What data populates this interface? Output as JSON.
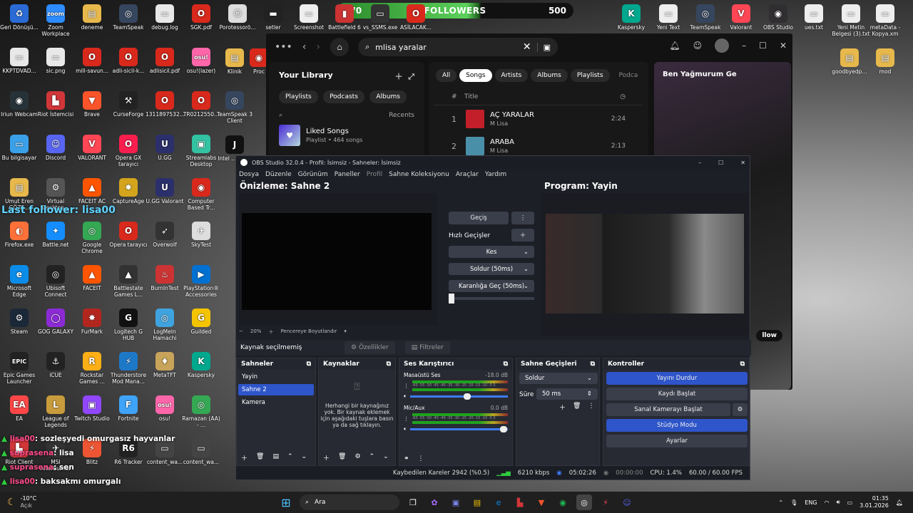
{
  "overlay": {
    "follow_current": "270",
    "follow_label": "FOLLOWERS",
    "follow_goal": "500",
    "last_follower": "Last follower: lisa00"
  },
  "desktop_icons": [
    {
      "label": "Geri Dönüşü...",
      "color": "#2a6bd6",
      "glyph": "♻"
    },
    {
      "label": "Zoom Workplace",
      "color": "#2d8cff",
      "glyph": "zoom"
    },
    {
      "label": "deneme",
      "color": "#e7b84b",
      "glyph": "▤"
    },
    {
      "label": "TeamSpeak",
      "color": "#36465e",
      "glyph": "◎"
    },
    {
      "label": "debug.log",
      "color": "#e8e8e8",
      "glyph": "▭"
    },
    {
      "label": "SGK.pdf",
      "color": "#d9291c",
      "glyph": "O"
    },
    {
      "label": "KKPTDVAD...",
      "color": "#e8e8e8",
      "glyph": "▭"
    },
    {
      "label": "sic.png",
      "color": "#e8e8e8",
      "glyph": "▭"
    },
    {
      "label": "mill-savun...",
      "color": "#d9291c",
      "glyph": "O"
    },
    {
      "label": "adli-sicil-k...",
      "color": "#d9291c",
      "glyph": "O"
    },
    {
      "label": "adlisicil.pdf",
      "color": "#d9291c",
      "glyph": "O"
    },
    {
      "label": "osu!(lazer)",
      "color": "#ff66aa",
      "glyph": "osu!"
    },
    {
      "label": "Iriun Webcam",
      "color": "#263238",
      "glyph": "◉"
    },
    {
      "label": "Riot İstemcisi",
      "color": "#d13639",
      "glyph": "▙"
    },
    {
      "label": "Brave",
      "color": "#fb542b",
      "glyph": "▼"
    },
    {
      "label": "CurseForge",
      "color": "#222",
      "glyph": "⚒"
    },
    {
      "label": "1311897532...",
      "color": "#d9291c",
      "glyph": "O"
    },
    {
      "label": "TR0212550...",
      "color": "#d9291c",
      "glyph": "O"
    },
    {
      "label": "Bu bilgisayar",
      "color": "#3aa0e8",
      "glyph": "▭"
    },
    {
      "label": "Discord",
      "color": "#5865f2",
      "glyph": "☺"
    },
    {
      "label": "VALORANT",
      "color": "#ff4655",
      "glyph": "V"
    },
    {
      "label": "Opera GX tarayıcı",
      "color": "#fa1e4e",
      "glyph": "O"
    },
    {
      "label": "U.GG",
      "color": "#2b2f6b",
      "glyph": "U"
    },
    {
      "label": "Streamlabs Desktop",
      "color": "#31c3a2",
      "glyph": "▣"
    },
    {
      "label": "Umut Eren GÖZE...",
      "color": "#e7b84b",
      "glyph": "▤"
    },
    {
      "label": "Virtual Desktop...",
      "color": "#555",
      "glyph": "⚙"
    },
    {
      "label": "FACEIT AC",
      "color": "#ff5500",
      "glyph": "▲"
    },
    {
      "label": "CaptureAge",
      "color": "#d4a51c",
      "glyph": "✸"
    },
    {
      "label": "U.GG Valorant",
      "color": "#2b2f6b",
      "glyph": "U"
    },
    {
      "label": "Computer Based Tr...",
      "color": "#d9291c",
      "glyph": "◉"
    },
    {
      "label": "Firefox.exe",
      "color": "#ff7139",
      "glyph": "◐"
    },
    {
      "label": "Battle.net",
      "color": "#148eff",
      "glyph": "✦"
    },
    {
      "label": "Google Chrome",
      "color": "#34a853",
      "glyph": "◎"
    },
    {
      "label": "Opera tarayıcı",
      "color": "#d9291c",
      "glyph": "O"
    },
    {
      "label": "Overwolf",
      "color": "#333",
      "glyph": "➶"
    },
    {
      "label": "SkyTest",
      "color": "#ddd",
      "glyph": "✈"
    },
    {
      "label": "Microsoft Edge",
      "color": "#0c8ce9",
      "glyph": "e"
    },
    {
      "label": "Ubisoft Connect",
      "color": "#222",
      "glyph": "◎"
    },
    {
      "label": "FACEIT",
      "color": "#ff5500",
      "glyph": "▲"
    },
    {
      "label": "Battlestate Games L...",
      "color": "#333",
      "glyph": "▲"
    },
    {
      "label": "BurnInTest",
      "color": "#c33",
      "glyph": "♨"
    },
    {
      "label": "PlayStation® Accessories",
      "color": "#0070d1",
      "glyph": "▶"
    },
    {
      "label": "Steam",
      "color": "#1b2838",
      "glyph": "⚙"
    },
    {
      "label": "GOG GALAXY",
      "color": "#8c2bd6",
      "glyph": "◯"
    },
    {
      "label": "FurMark",
      "color": "#b3261e",
      "glyph": "✸"
    },
    {
      "label": "Logitech G HUB",
      "color": "#111",
      "glyph": "G"
    },
    {
      "label": "LogMeIn Hamachi",
      "color": "#3fa3e0",
      "glyph": "◎"
    },
    {
      "label": "Guilded",
      "color": "#f5c400",
      "glyph": "G"
    },
    {
      "label": "Epic Games Launcher",
      "color": "#222",
      "glyph": "EPIC"
    },
    {
      "label": "iCUE",
      "color": "#222",
      "glyph": "⚓"
    },
    {
      "label": "Rockstar Games ...",
      "color": "#fcaf17",
      "glyph": "R"
    },
    {
      "label": "Thunderstore Mod Mana...",
      "color": "#1e78c8",
      "glyph": "⚡"
    },
    {
      "label": "MetaTFT",
      "color": "#c8a45a",
      "glyph": "♦"
    },
    {
      "label": "Kaspersky",
      "color": "#00a88e",
      "glyph": "K"
    },
    {
      "label": "EA",
      "color": "#ff4747",
      "glyph": "EA"
    },
    {
      "label": "League of Legends",
      "color": "#c89b3c",
      "glyph": "L"
    },
    {
      "label": "Twitch Studio",
      "color": "#9146ff",
      "glyph": "▣"
    },
    {
      "label": "Fortnite",
      "color": "#3fa3f8",
      "glyph": "F"
    },
    {
      "label": "osu!",
      "color": "#ff66aa",
      "glyph": "osu!"
    },
    {
      "label": "Ramazan (AA) - ...",
      "color": "#34a853",
      "glyph": "◎"
    },
    {
      "label": "Riot Client",
      "color": "#d13639",
      "glyph": "▙"
    },
    {
      "label": "MSI Afterburner",
      "color": "#333",
      "glyph": "✈"
    },
    {
      "label": "Blitz",
      "color": "#e53",
      "glyph": "⚡"
    },
    {
      "label": "R6 Tracker",
      "color": "#222",
      "glyph": "R6"
    },
    {
      "label": "content_wa...",
      "color": "#444",
      "glyph": "▭"
    },
    {
      "label": "content_wa...",
      "color": "#444",
      "glyph": "▭"
    }
  ],
  "top_icons": [
    {
      "label": "Porotessorö...",
      "color": "#ddd",
      "glyph": "☺"
    },
    {
      "label": "setler",
      "color": "#222",
      "glyph": "▬"
    },
    {
      "label": "Screenshot",
      "color": "#eee",
      "glyph": "▭"
    },
    {
      "label": "Battlefield 6",
      "color": "#c33",
      "glyph": "▮"
    },
    {
      "label": "vs_SSMS.exe",
      "color": "#333",
      "glyph": "▭"
    },
    {
      "label": "ASİLACAK...",
      "color": "#d9291c",
      "glyph": "O"
    }
  ],
  "right_icons": [
    {
      "label": "Kaspersky",
      "color": "#00a88e",
      "glyph": "K"
    },
    {
      "label": "Yeni Text",
      "color": "#eee",
      "glyph": "▭"
    },
    {
      "label": "TeamSpeak",
      "color": "#36465e",
      "glyph": "◎"
    },
    {
      "label": "Valorant",
      "color": "#ff4655",
      "glyph": "V"
    },
    {
      "label": "OBS Studio",
      "color": "#302e31",
      "glyph": "◉"
    },
    {
      "label": "ues.txt",
      "color": "#eee",
      "glyph": "▭"
    },
    {
      "label": "Yeni Metin Belgesi (3).txt",
      "color": "#eee",
      "glyph": "▭"
    },
    {
      "label": "metaData - Kopya.xm",
      "color": "#eee",
      "glyph": "▭"
    },
    {
      "label": "goodbyedp...",
      "color": "#e7b84b",
      "glyph": "▤"
    },
    {
      "label": "mod",
      "color": "#e7b84b",
      "glyph": "▤"
    }
  ],
  "mid_icons": [
    {
      "label": "Klinik",
      "color": "#e7b84b",
      "glyph": "▤"
    },
    {
      "label": "Proc",
      "color": "#d9291c",
      "glyph": "◉"
    },
    {
      "label": "TeamSpeak 3 Client",
      "color": "#36465e",
      "glyph": "◎"
    },
    {
      "label": "Intel ... 2024",
      "color": "#111",
      "glyph": "J"
    }
  ],
  "spotify": {
    "search_value": "mlisa yaralar",
    "library_title": "Your Library",
    "lib_chips": [
      "Playlists",
      "Podcasts",
      "Albums"
    ],
    "recents": "Recents",
    "liked_title": "Liked Songs",
    "liked_sub": "Playlist • 464 songs",
    "tabs": [
      "All",
      "Songs",
      "Artists",
      "Albums",
      "Playlists",
      "Podca"
    ],
    "col_num": "#",
    "col_title": "Title",
    "tracks": [
      {
        "n": "1",
        "title": "AÇ YARALAR",
        "artist": "M Lisa",
        "dur": "2:24"
      },
      {
        "n": "2",
        "title": "ARABA",
        "artist": "M Lisa",
        "dur": "2:13"
      }
    ],
    "now_playing": "Ben Yağmurum Ge",
    "follow_btn": "llow"
  },
  "obs": {
    "title": "OBS Studio 32.0.4 - Profil: İsimsiz - Sahneler: İsimsiz",
    "menu": [
      "Dosya",
      "Düzenle",
      "Görünüm",
      "Paneller",
      "Profil",
      "Sahne Koleksiyonu",
      "Araçlar",
      "Yardım"
    ],
    "preview_title": "Önizleme: Sahne 2",
    "program_title": "Program: Yayin",
    "transition_btn": "Geçiş",
    "quick_label": "Hızlı Geçişler",
    "quick_items": [
      "Kes",
      "Soldur (50ms)",
      "Karanlığa Geç (50ms)"
    ],
    "zoom_label": "20%",
    "fit_label": "Pencereye Boyutlandır",
    "no_source": "Kaynak seçilmemiş",
    "properties": "Özellikler",
    "filters": "Filtreler",
    "scenes_title": "Sahneler",
    "scenes": [
      "Yayin",
      "Sahne 2",
      "Kamera"
    ],
    "sources_title": "Kaynaklar",
    "sources_empty": "Herhangi bir kaynağınız yok. Bir kaynak eklemek için aşağıdaki tuşlara basın ya da sağ tıklayın.",
    "mixer_title": "Ses Karıştırıcı",
    "mixer": [
      {
        "name": "Masaüstü Ses",
        "db": "-18.0 dB"
      },
      {
        "name": "Mic/Aux",
        "db": "0.0 dB"
      }
    ],
    "meter_ticks": "-60 -55 -50 -45 -40 -35 -30 -25 -20 -15 -10 -5 0",
    "trans_title": "Sahne Geçişleri",
    "trans_value": "Soldur",
    "duration_label": "Süre",
    "duration_value": "50 ms",
    "controls_title": "Kontroller",
    "controls": [
      "Yayını Durdur",
      "Kaydı Başlat",
      "Sanal Kamerayı Başlat",
      "Stüdyo Modu",
      "Ayarlar"
    ],
    "status": {
      "dropped": "Kaybedilen Kareler 2942 (%0.5)",
      "bitrate": "6210 kbps",
      "live": "05:02:26",
      "rec": "00:00:00",
      "cpu": "CPU: 1.4%",
      "fps": "60.00 / 60.00 FPS"
    }
  },
  "chat": [
    {
      "user": "lisa00",
      "msg": ": sozleşyedi omurgasız hayvanlar"
    },
    {
      "user": "suprasena",
      "msg": ": lisa"
    },
    {
      "user": "suprasena",
      "msg": ": sen"
    },
    {
      "user": "lisa00",
      "msg": ": baksakmı omurgalı"
    }
  ],
  "weather": {
    "temp": "-10°C",
    "cond": "Açık"
  },
  "taskbar": {
    "search": "Ara",
    "lang": "ENG",
    "time": "01:35",
    "date": "3.01.2026"
  }
}
